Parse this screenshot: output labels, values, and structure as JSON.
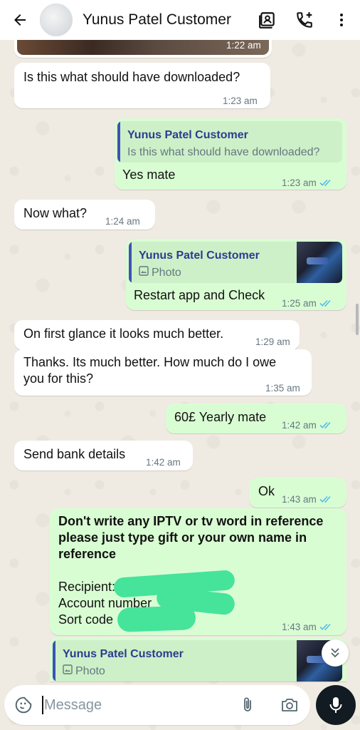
{
  "header": {
    "contact_name": "Yunus Patel Customer",
    "icons": [
      "back-arrow-icon",
      "contact-card-icon",
      "add-call-icon",
      "more-vert-icon"
    ]
  },
  "messages": [
    {
      "dir": "in",
      "type": "image-bottom",
      "time": "1:22 am"
    },
    {
      "dir": "in",
      "text": "Is this what should have downloaded?",
      "time": "1:23 am"
    },
    {
      "dir": "out",
      "quote_name": "Yunus Patel Customer",
      "quote_text": "Is this what should have downloaded?",
      "text": "Yes mate",
      "time": "1:23 am",
      "status": "read"
    },
    {
      "dir": "in",
      "text": "Now what?",
      "time": "1:24 am"
    },
    {
      "dir": "out",
      "quote_name": "Yunus Patel Customer",
      "quote_text": "Photo",
      "text": "Restart app and Check",
      "time": "1:25 am",
      "status": "read"
    },
    {
      "dir": "in",
      "text": "On first glance it looks much better.",
      "time": "1:29 am"
    },
    {
      "dir": "in",
      "text_line1": "Thanks. Its much better. How much do I owe",
      "text_line2": "you for this?",
      "time": "1:35 am"
    },
    {
      "dir": "out",
      "text": "60£ Yearly mate",
      "time": "1:42 am",
      "status": "read"
    },
    {
      "dir": "in",
      "text": "Send bank details",
      "time": "1:42 am"
    },
    {
      "dir": "out",
      "text": "Ok",
      "time": "1:43 am",
      "status": "read"
    },
    {
      "dir": "out",
      "bold_line1": "Don't write any IPTV or tv word in reference",
      "bold_line2": "please just type gift or your own name in",
      "bold_line3": "reference",
      "line1": "Recipient:",
      "line2": "Account number",
      "line3": "Sort code",
      "time": "1:43 am",
      "status": "read"
    },
    {
      "dir": "out",
      "quote_name": "Yunus Patel Customer",
      "quote_text": "Photo"
    }
  ],
  "input": {
    "placeholder": "Message"
  },
  "colors": {
    "outgoing": "#d9fdd3",
    "incoming": "#ffffff",
    "read_ticks": "#53bdeb",
    "quote_bar": "#3f51b5",
    "redaction": "#46e39b"
  }
}
